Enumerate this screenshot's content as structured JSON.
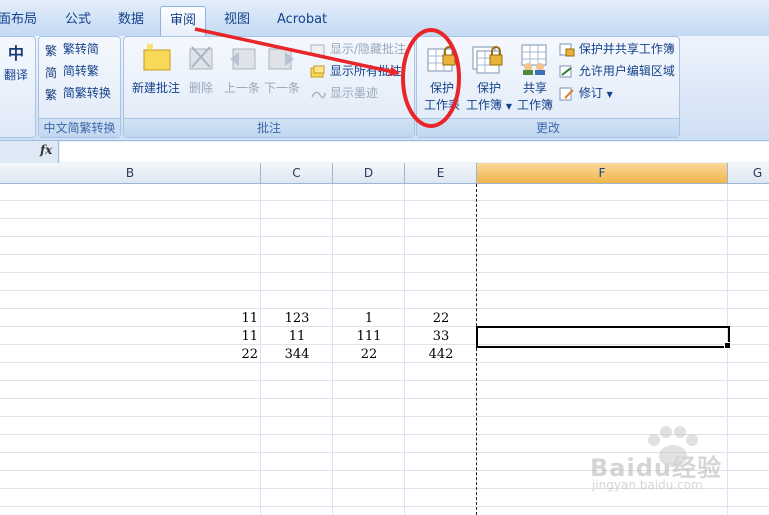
{
  "tabs": [
    {
      "label": "页面布局",
      "visible": "面布局",
      "active": false
    },
    {
      "label": "公式",
      "active": false
    },
    {
      "label": "数据",
      "active": false
    },
    {
      "label": "审阅",
      "active": true
    },
    {
      "label": "视图",
      "active": false
    },
    {
      "label": "Acrobat",
      "active": false
    }
  ],
  "ribbon": {
    "proofing": {
      "translate_label": "翻译",
      "translate_glyph": "中"
    },
    "chinese_conversion": {
      "title": "中文简繁转换",
      "to_simplified": "繁转简",
      "to_traditional": "简转繁",
      "conversion": "简繁转换"
    },
    "comments": {
      "title": "批注",
      "new": "新建批注",
      "delete": "删除",
      "prev": "上一条",
      "next": "下一条",
      "show_hide": "显示/隐藏批注",
      "show_all": "显示所有批注",
      "show_ink": "显示墨迹"
    },
    "changes": {
      "title": "更改",
      "protect_sheet_1": "保护",
      "protect_sheet_2": "工作表",
      "protect_book_1": "保护",
      "protect_book_2": "工作簿",
      "share_book_1": "共享",
      "share_book_2": "工作簿",
      "protect_share": "保护并共享工作簿",
      "allow_edit_ranges": "允许用户编辑区域",
      "track_changes": "修订"
    }
  },
  "formula_bar": {
    "fx_label": "fx",
    "value": ""
  },
  "columns": [
    "B",
    "C",
    "D",
    "E",
    "F",
    "G"
  ],
  "selected_column": "F",
  "rows": [
    [
      "11",
      "123",
      "1",
      "22"
    ],
    [
      "11",
      "11",
      "111",
      "33"
    ],
    [
      "22",
      "344",
      "22",
      "442"
    ]
  ],
  "watermark": {
    "brand": "Baidu经验",
    "url": "jingyan.baidu.com"
  },
  "colors": {
    "annotation": "#e8262a",
    "accent": "#15428b",
    "selected_header": "#f1b54b"
  }
}
